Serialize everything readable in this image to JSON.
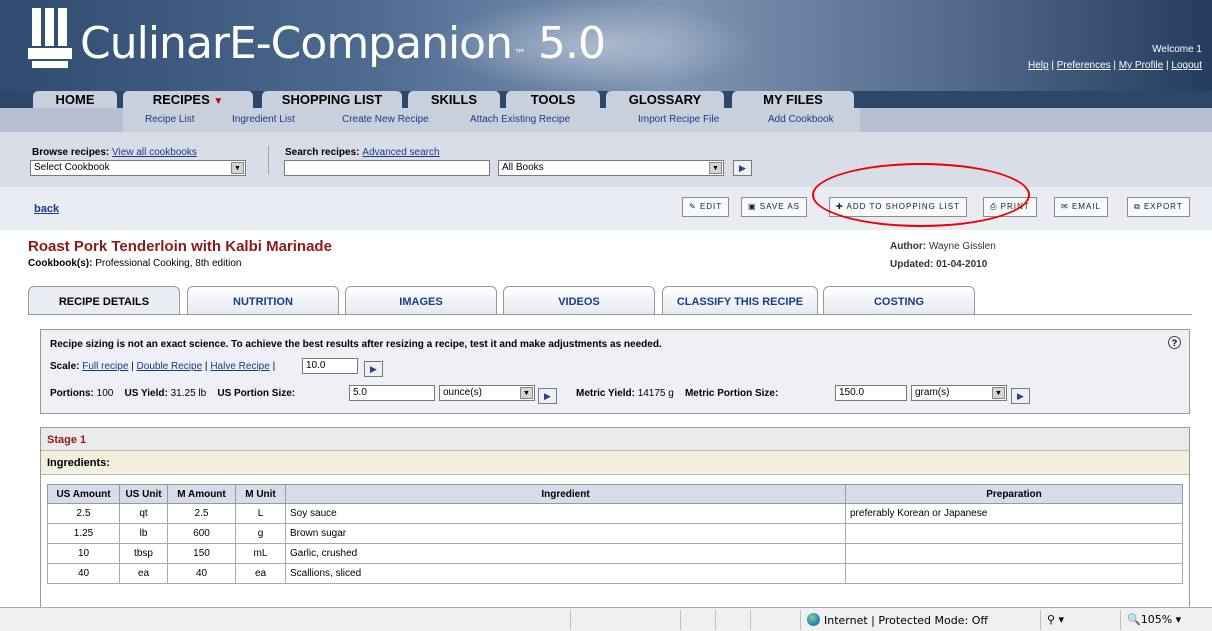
{
  "app": {
    "title_main": "CulinarE-Companion",
    "title_tm": "™",
    "title_version": "5.0",
    "welcome": "Welcome 1",
    "links": [
      "Help",
      "Preferences",
      "My Profile",
      "Logout"
    ]
  },
  "nav": {
    "tabs": [
      "HOME",
      "RECIPES",
      "SHOPPING LIST",
      "SKILLS",
      "TOOLS",
      "GLOSSARY",
      "MY FILES"
    ],
    "sub": [
      "Recipe List",
      "Ingredient List",
      "Create New Recipe",
      "Attach Existing Recipe",
      "Import Recipe File",
      "Add Cookbook"
    ]
  },
  "search": {
    "browse_label": "Browse recipes:",
    "browse_link": "View all cookbooks",
    "cookbook_select": "Select Cookbook",
    "search_label": "Search recipes:",
    "search_link": "Advanced search",
    "search_value": "",
    "books_select": "All Books"
  },
  "toolbar": {
    "back": "back",
    "edit": "EDIT",
    "save_as": "SAVE AS",
    "add_shopping": "ADD TO SHOPPING LIST",
    "print": "PRINT",
    "email": "EMAIL",
    "export": "EXPORT"
  },
  "recipe": {
    "title": "Roast Pork Tenderloin with Kalbi Marinade",
    "cookbook_label": "Cookbook(s):",
    "cookbook": "Professional Cooking, 8th edition",
    "author_label": "Author:",
    "author": "Wayne Gisslen",
    "updated_label": "Updated:",
    "updated": "01-04-2010"
  },
  "recipe_tabs": [
    "RECIPE DETAILS",
    "NUTRITION",
    "IMAGES",
    "VIDEOS",
    "CLASSIFY THIS RECIPE",
    "COSTING"
  ],
  "sizing": {
    "notice": "Recipe sizing is not an exact science. To achieve the best results after resizing a recipe, test it and make adjustments as needed.",
    "help": "?",
    "scale_label": "Scale:",
    "scale_links": [
      "Full recipe",
      "Double Recipe",
      "Halve Recipe"
    ],
    "scale_value": "10.0",
    "portions_label": "Portions:",
    "portions": "100",
    "us_yield_label": "US Yield:",
    "us_yield": "31.25 lb",
    "us_portion_label": "US Portion Size:",
    "us_portion": "5.0",
    "us_unit": "ounce(s)",
    "metric_yield_label": "Metric Yield:",
    "metric_yield": "14175 g",
    "metric_portion_label": "Metric Portion Size:",
    "metric_portion": "150.0",
    "metric_unit": "gram(s)"
  },
  "stage": {
    "title": "Stage 1",
    "ingredients_label": "Ingredients:",
    "columns": [
      "US Amount",
      "US Unit",
      "M Amount",
      "M Unit",
      "Ingredient",
      "Preparation"
    ],
    "rows": [
      [
        "2.5",
        "qt",
        "2.5",
        "L",
        "Soy sauce",
        "preferably Korean or Japanese"
      ],
      [
        "1.25",
        "lb",
        "600",
        "g",
        "Brown sugar",
        ""
      ],
      [
        "10",
        "tbsp",
        "150",
        "mL",
        "Garlic, crushed",
        ""
      ],
      [
        "40",
        "ea",
        "40",
        "ea",
        "Scallions, sliced",
        ""
      ]
    ]
  },
  "status": {
    "zone": "Internet | Protected Mode: Off",
    "zoom": "105%"
  }
}
